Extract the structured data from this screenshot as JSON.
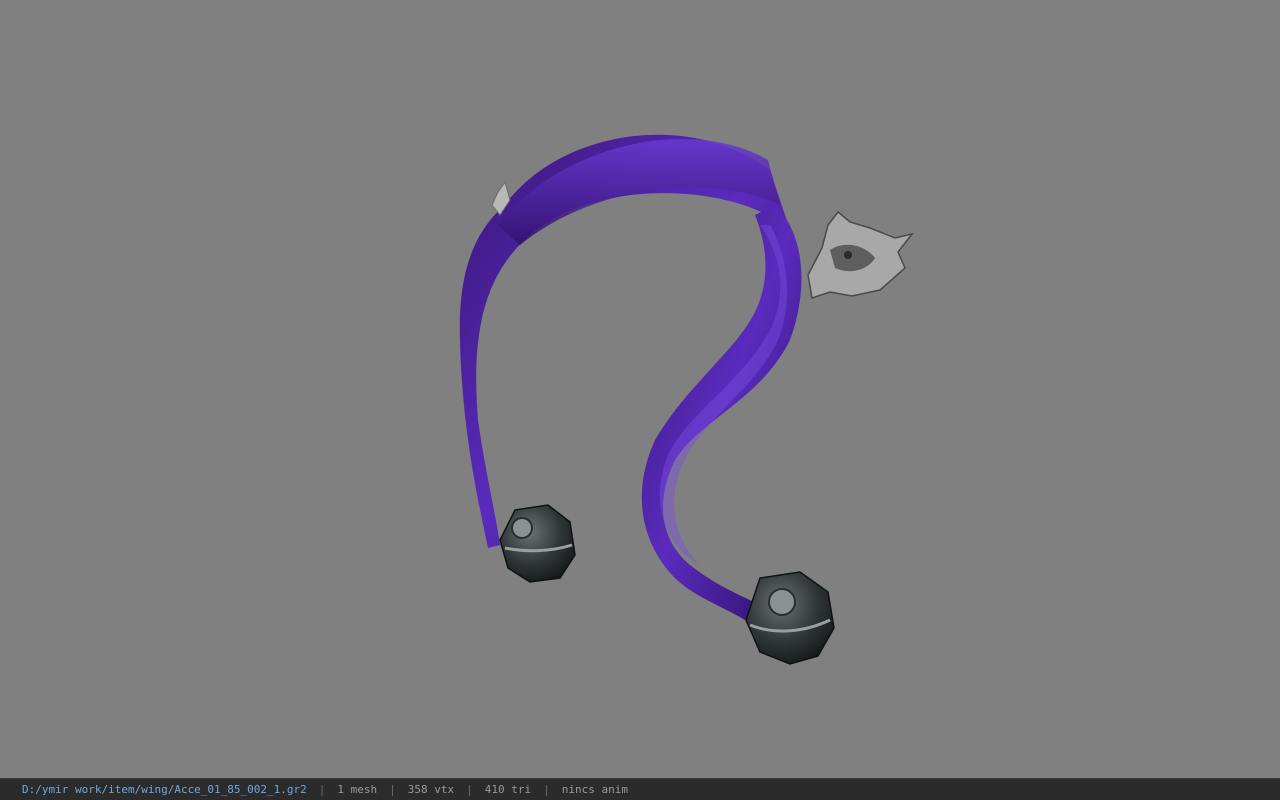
{
  "viewport": {
    "background": "#808080",
    "model": {
      "scarf_color": "#4a1f9c",
      "ornament_color": "#3a3f3f",
      "metal_color": "#c9c9c9"
    }
  },
  "statusbar": {
    "path": "D:/ymir work/item/wing/Acce_01_85_002_1.gr2",
    "sep": "|",
    "mesh": "1 mesh",
    "vtx": "358 vtx",
    "tri": "410 tri",
    "anim": "nincs anim"
  }
}
